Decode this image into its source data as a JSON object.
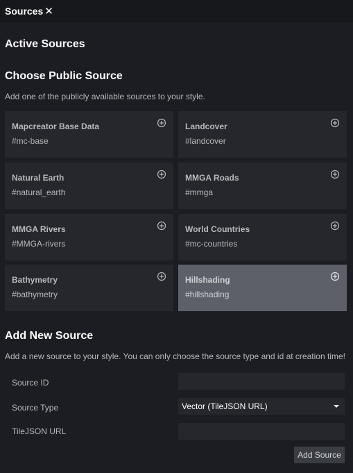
{
  "tab": {
    "label": "Sources",
    "close_glyph": "✕"
  },
  "active": {
    "heading": "Active Sources"
  },
  "public": {
    "heading": "Choose Public Source",
    "description": "Add one of the publicly available sources to your style.",
    "sources": [
      {
        "name": "Mapcreator Base Data",
        "id": "#mc-base"
      },
      {
        "name": "Landcover",
        "id": "#landcover"
      },
      {
        "name": "Natural Earth",
        "id": "#natural_earth"
      },
      {
        "name": "MMGA Roads",
        "id": "#mmga"
      },
      {
        "name": "MMGA Rivers",
        "id": "#MMGA-rivers"
      },
      {
        "name": "World Countries",
        "id": "#mc-countries"
      },
      {
        "name": "Bathymetry",
        "id": "#bathymetry"
      },
      {
        "name": "Hillshading",
        "id": "#hillshading"
      }
    ],
    "add_icon": "plus-circle-icon"
  },
  "new_source": {
    "heading": "Add New Source",
    "description": "Add a new source to your style. You can only choose the source type and id at creation time!",
    "id_label": "Source ID",
    "id_value": "",
    "type_label": "Source Type",
    "type_value": "Vector (TileJSON URL)",
    "url_label": "TileJSON URL",
    "url_value": "",
    "button_label": "Add Source"
  },
  "colors": {
    "background": "#1c1d22",
    "titlebar": "#17181c",
    "card": "#26272c",
    "card_highlight": "#5d6069",
    "button": "#3b3d44"
  }
}
